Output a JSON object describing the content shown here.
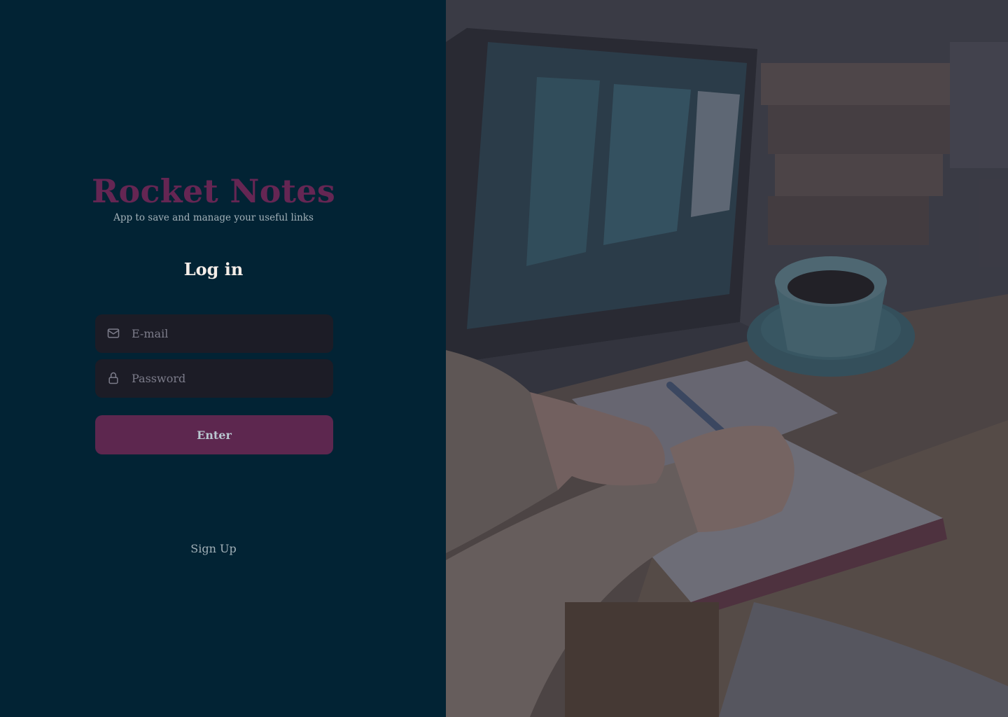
{
  "app": {
    "title": "Rocket Notes",
    "tagline": "App to save and manage your useful links"
  },
  "form": {
    "title": "Log in",
    "email": {
      "placeholder": "E-mail",
      "value": "",
      "icon": "mail-icon"
    },
    "password": {
      "placeholder": "Password",
      "value": "",
      "icon": "lock-icon"
    },
    "submit_label": "Enter",
    "signup_label": "Sign Up"
  },
  "colors": {
    "background": "#022334",
    "brand": "#652653",
    "button": "#5d274f",
    "input_bg": "#1c1c26",
    "placeholder": "#7c7c8a"
  },
  "background_image": {
    "subject": "person writing in notebook next to laptop and coffee cup"
  }
}
